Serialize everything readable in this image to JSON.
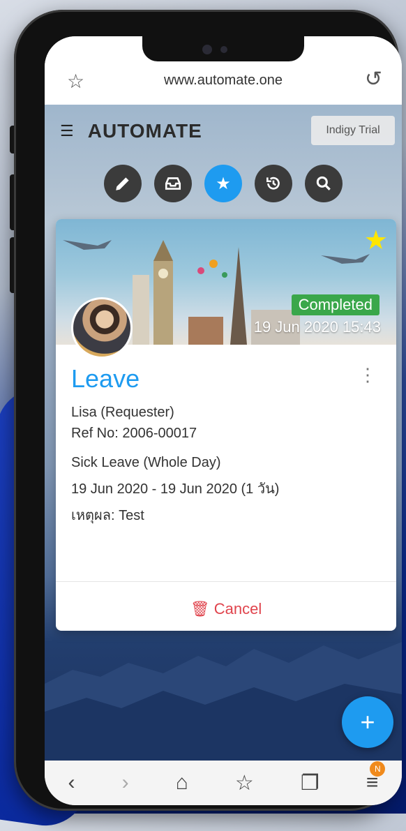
{
  "browser": {
    "url": "www.automate.one"
  },
  "app": {
    "brand": "AUTOMATE",
    "trial_label": "Indigy Trial"
  },
  "actions": [
    {
      "name": "edit",
      "icon": "pencil-icon"
    },
    {
      "name": "inbox",
      "icon": "inbox-icon"
    },
    {
      "name": "favorites",
      "icon": "star-icon",
      "active": true
    },
    {
      "name": "history",
      "icon": "history-icon"
    },
    {
      "name": "search",
      "icon": "search-icon"
    }
  ],
  "card": {
    "status": "Completed",
    "datetime": "19 Jun 2020 15:43",
    "title": "Leave",
    "requester": "Lisa (Requester)",
    "ref": "Ref No: 2006-00017",
    "leave_type": "Sick Leave (Whole Day)",
    "date_range": "19 Jun 2020 - 19 Jun 2020 (1 วัน)",
    "reason": "เหตุผล: Test",
    "cancel_label": "Cancel"
  },
  "navbar": {
    "tabs_badge": "N"
  },
  "colors": {
    "accent": "#1e9bf0",
    "status_green": "#3aa74a",
    "cancel_red": "#e0444d",
    "star_yellow": "#ffe600"
  }
}
